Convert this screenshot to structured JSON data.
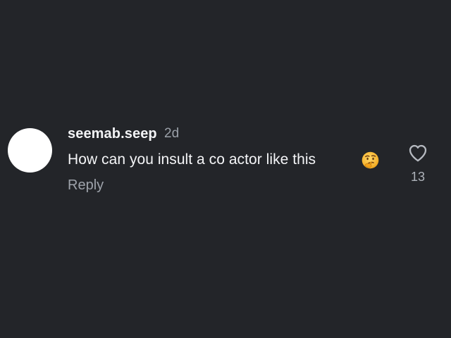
{
  "comment": {
    "username": "seemab.seep",
    "timestamp": "2d",
    "text": "How can you insult a co actor like this",
    "emoji": "thinking-face",
    "reply_label": "Reply",
    "like_count": "13",
    "like_icon": "heart-outline-icon"
  },
  "colors": {
    "background": "#232529",
    "avatar": "#ffffff",
    "primary_text": "#f4f5f7",
    "secondary_text": "#9ea3ab"
  }
}
